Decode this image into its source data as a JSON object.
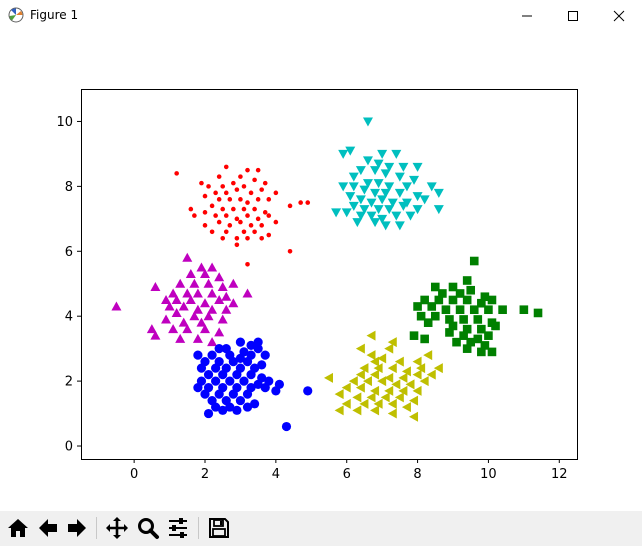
{
  "window": {
    "title": "Figure 1",
    "icon": "matplotlib-icon",
    "controls": [
      "minimize-icon",
      "maximize-icon",
      "close-icon"
    ]
  },
  "toolbar": {
    "buttons": [
      "home-icon",
      "back-icon",
      "forward-icon",
      "pan-icon",
      "zoom-icon",
      "configure-subplots-icon",
      "save-icon"
    ]
  },
  "chart_data": {
    "type": "scatter",
    "title": "",
    "xlabel": "",
    "ylabel": "",
    "xlim": [
      -1.5,
      12.5
    ],
    "ylim": [
      -0.4,
      11.0
    ],
    "xticks": [
      "0",
      "2",
      "4",
      "6",
      "8",
      "10",
      "12"
    ],
    "yticks": [
      "0",
      "2",
      "4",
      "6",
      "8",
      "10"
    ],
    "grid": false,
    "legend": "none",
    "series": [
      {
        "color": "#ff0000",
        "marker": "point",
        "points": [
          [
            1.2,
            8.4
          ],
          [
            2.6,
            8.6
          ],
          [
            3.2,
            8.5
          ],
          [
            3.5,
            8.5
          ],
          [
            2.4,
            8.3
          ],
          [
            3.0,
            8.3
          ],
          [
            1.9,
            8.1
          ],
          [
            2.1,
            8.0
          ],
          [
            2.5,
            8.0
          ],
          [
            2.8,
            8.1
          ],
          [
            3.1,
            8.0
          ],
          [
            3.4,
            8.2
          ],
          [
            3.7,
            8.1
          ],
          [
            2.3,
            7.8
          ],
          [
            2.6,
            7.8
          ],
          [
            2.9,
            7.9
          ],
          [
            3.3,
            7.8
          ],
          [
            3.6,
            7.9
          ],
          [
            4.0,
            7.8
          ],
          [
            2.0,
            7.7
          ],
          [
            2.4,
            7.6
          ],
          [
            2.7,
            7.6
          ],
          [
            3.0,
            7.6
          ],
          [
            3.2,
            7.5
          ],
          [
            3.5,
            7.6
          ],
          [
            3.8,
            7.6
          ],
          [
            4.7,
            7.5
          ],
          [
            4.9,
            7.5
          ],
          [
            1.6,
            7.3
          ],
          [
            2.2,
            7.4
          ],
          [
            2.5,
            7.3
          ],
          [
            2.8,
            7.3
          ],
          [
            3.1,
            7.3
          ],
          [
            3.4,
            7.3
          ],
          [
            3.7,
            7.2
          ],
          [
            4.4,
            7.4
          ],
          [
            1.7,
            7.1
          ],
          [
            2.0,
            7.2
          ],
          [
            2.3,
            7.1
          ],
          [
            2.6,
            7.1
          ],
          [
            2.9,
            7.0
          ],
          [
            3.2,
            7.1
          ],
          [
            3.5,
            7.0
          ],
          [
            3.8,
            7.1
          ],
          [
            2.0,
            6.8
          ],
          [
            2.4,
            6.9
          ],
          [
            2.7,
            6.8
          ],
          [
            3.0,
            6.9
          ],
          [
            3.3,
            6.8
          ],
          [
            3.6,
            6.8
          ],
          [
            4.0,
            6.9
          ],
          [
            2.2,
            6.6
          ],
          [
            2.6,
            6.6
          ],
          [
            3.1,
            6.6
          ],
          [
            3.4,
            6.6
          ],
          [
            3.8,
            6.5
          ],
          [
            2.5,
            6.4
          ],
          [
            2.9,
            6.4
          ],
          [
            3.2,
            6.4
          ],
          [
            3.6,
            6.4
          ],
          [
            2.9,
            6.2
          ],
          [
            4.4,
            6.0
          ],
          [
            3.2,
            5.6
          ]
        ]
      },
      {
        "color": "#00bfbf",
        "marker": "triangle_down",
        "points": [
          [
            6.6,
            10.0
          ],
          [
            5.9,
            9.0
          ],
          [
            6.1,
            9.1
          ],
          [
            7.0,
            9.0
          ],
          [
            7.4,
            9.0
          ],
          [
            6.6,
            8.8
          ],
          [
            6.9,
            8.7
          ],
          [
            7.2,
            8.6
          ],
          [
            6.4,
            8.5
          ],
          [
            7.6,
            8.6
          ],
          [
            8.0,
            8.6
          ],
          [
            6.8,
            8.5
          ],
          [
            7.1,
            8.4
          ],
          [
            6.2,
            8.3
          ],
          [
            7.5,
            8.3
          ],
          [
            7.9,
            8.2
          ],
          [
            6.6,
            8.1
          ],
          [
            6.9,
            8.1
          ],
          [
            7.2,
            8.0
          ],
          [
            5.9,
            8.0
          ],
          [
            6.2,
            8.0
          ],
          [
            7.7,
            8.0
          ],
          [
            8.4,
            8.0
          ],
          [
            6.5,
            7.9
          ],
          [
            6.8,
            7.8
          ],
          [
            7.1,
            7.8
          ],
          [
            7.5,
            7.8
          ],
          [
            8.0,
            7.7
          ],
          [
            8.6,
            7.8
          ],
          [
            6.1,
            7.7
          ],
          [
            6.4,
            7.6
          ],
          [
            6.7,
            7.5
          ],
          [
            7.0,
            7.6
          ],
          [
            7.3,
            7.5
          ],
          [
            7.7,
            7.5
          ],
          [
            8.2,
            7.6
          ],
          [
            6.2,
            7.4
          ],
          [
            6.5,
            7.3
          ],
          [
            6.9,
            7.3
          ],
          [
            7.2,
            7.3
          ],
          [
            7.6,
            7.4
          ],
          [
            8.0,
            7.3
          ],
          [
            8.6,
            7.3
          ],
          [
            5.7,
            7.2
          ],
          [
            6.0,
            7.2
          ],
          [
            6.4,
            7.1
          ],
          [
            6.7,
            7.1
          ],
          [
            7.0,
            7.0
          ],
          [
            7.4,
            7.1
          ],
          [
            7.8,
            7.1
          ],
          [
            6.3,
            6.9
          ],
          [
            6.8,
            6.9
          ],
          [
            7.5,
            6.8
          ],
          [
            7.1,
            6.8
          ]
        ]
      },
      {
        "color": "#bf00bf",
        "marker": "triangle_up",
        "points": [
          [
            1.5,
            5.8
          ],
          [
            1.9,
            5.5
          ],
          [
            2.2,
            5.5
          ],
          [
            1.6,
            5.3
          ],
          [
            2.0,
            5.3
          ],
          [
            2.4,
            5.2
          ],
          [
            0.6,
            4.9
          ],
          [
            1.3,
            5.0
          ],
          [
            1.7,
            5.0
          ],
          [
            2.1,
            5.0
          ],
          [
            2.5,
            4.9
          ],
          [
            2.8,
            5.0
          ],
          [
            1.1,
            4.7
          ],
          [
            1.5,
            4.7
          ],
          [
            1.8,
            4.7
          ],
          [
            2.2,
            4.7
          ],
          [
            2.6,
            4.6
          ],
          [
            3.2,
            4.7
          ],
          [
            0.9,
            4.5
          ],
          [
            1.2,
            4.5
          ],
          [
            1.6,
            4.5
          ],
          [
            2.0,
            4.4
          ],
          [
            2.4,
            4.5
          ],
          [
            2.8,
            4.4
          ],
          [
            -0.5,
            4.3
          ],
          [
            1.0,
            4.3
          ],
          [
            1.4,
            4.3
          ],
          [
            1.8,
            4.2
          ],
          [
            2.2,
            4.2
          ],
          [
            2.6,
            4.2
          ],
          [
            1.2,
            4.1
          ],
          [
            1.7,
            4.0
          ],
          [
            2.1,
            4.0
          ],
          [
            2.5,
            3.9
          ],
          [
            0.9,
            3.9
          ],
          [
            1.4,
            3.8
          ],
          [
            1.9,
            3.8
          ],
          [
            0.5,
            3.6
          ],
          [
            1.1,
            3.6
          ],
          [
            1.5,
            3.6
          ],
          [
            2.0,
            3.6
          ],
          [
            2.4,
            3.5
          ],
          [
            0.6,
            3.4
          ],
          [
            1.8,
            3.3
          ],
          [
            2.2,
            3.2
          ],
          [
            1.3,
            3.3
          ]
        ]
      },
      {
        "color": "#0000ff",
        "marker": "circle",
        "points": [
          [
            3.5,
            3.2
          ],
          [
            3.0,
            3.2
          ],
          [
            3.3,
            3.1
          ],
          [
            2.6,
            3.0
          ],
          [
            2.4,
            3.0
          ],
          [
            3.5,
            3.0
          ],
          [
            3.1,
            2.9
          ],
          [
            1.8,
            2.8
          ],
          [
            2.2,
            2.8
          ],
          [
            2.7,
            2.8
          ],
          [
            3.0,
            2.7
          ],
          [
            3.3,
            2.8
          ],
          [
            3.7,
            2.8
          ],
          [
            2.0,
            2.6
          ],
          [
            2.4,
            2.6
          ],
          [
            2.8,
            2.6
          ],
          [
            3.2,
            2.6
          ],
          [
            3.6,
            2.5
          ],
          [
            1.9,
            2.4
          ],
          [
            2.3,
            2.4
          ],
          [
            2.6,
            2.4
          ],
          [
            3.0,
            2.4
          ],
          [
            3.4,
            2.4
          ],
          [
            2.1,
            2.2
          ],
          [
            2.5,
            2.2
          ],
          [
            2.9,
            2.2
          ],
          [
            3.3,
            2.2
          ],
          [
            3.6,
            2.1
          ],
          [
            1.9,
            2.0
          ],
          [
            2.3,
            2.0
          ],
          [
            2.7,
            2.0
          ],
          [
            3.1,
            2.0
          ],
          [
            3.5,
            1.9
          ],
          [
            3.8,
            2.0
          ],
          [
            4.1,
            1.9
          ],
          [
            1.8,
            1.8
          ],
          [
            2.1,
            1.8
          ],
          [
            2.5,
            1.8
          ],
          [
            2.9,
            1.8
          ],
          [
            3.3,
            1.8
          ],
          [
            3.7,
            1.8
          ],
          [
            4.0,
            1.7
          ],
          [
            4.9,
            1.7
          ],
          [
            2.0,
            1.6
          ],
          [
            2.4,
            1.6
          ],
          [
            2.8,
            1.6
          ],
          [
            3.2,
            1.6
          ],
          [
            2.2,
            1.4
          ],
          [
            2.6,
            1.4
          ],
          [
            3.0,
            1.4
          ],
          [
            3.4,
            1.3
          ],
          [
            2.3,
            1.2
          ],
          [
            2.7,
            1.2
          ],
          [
            3.2,
            1.2
          ],
          [
            2.9,
            1.1
          ],
          [
            2.1,
            1.0
          ],
          [
            2.5,
            1.1
          ],
          [
            4.3,
            0.6
          ]
        ]
      },
      {
        "color": "#bfbf00",
        "marker": "triangle_left",
        "points": [
          [
            6.7,
            3.4
          ],
          [
            7.3,
            3.2
          ],
          [
            7.2,
            3.0
          ],
          [
            6.4,
            3.0
          ],
          [
            6.7,
            2.8
          ],
          [
            7.0,
            2.7
          ],
          [
            8.3,
            2.8
          ],
          [
            6.8,
            2.6
          ],
          [
            7.5,
            2.6
          ],
          [
            8.0,
            2.6
          ],
          [
            6.5,
            2.4
          ],
          [
            6.9,
            2.4
          ],
          [
            7.3,
            2.4
          ],
          [
            7.7,
            2.3
          ],
          [
            8.1,
            2.4
          ],
          [
            8.6,
            2.4
          ],
          [
            6.4,
            2.2
          ],
          [
            6.8,
            2.2
          ],
          [
            7.2,
            2.1
          ],
          [
            7.6,
            2.1
          ],
          [
            8.0,
            2.2
          ],
          [
            8.4,
            2.2
          ],
          [
            5.5,
            2.1
          ],
          [
            6.2,
            2.0
          ],
          [
            6.6,
            2.0
          ],
          [
            7.0,
            2.0
          ],
          [
            7.4,
            1.9
          ],
          [
            7.8,
            1.9
          ],
          [
            8.2,
            2.0
          ],
          [
            6.0,
            1.8
          ],
          [
            6.4,
            1.8
          ],
          [
            6.8,
            1.7
          ],
          [
            7.2,
            1.7
          ],
          [
            7.6,
            1.7
          ],
          [
            8.0,
            1.7
          ],
          [
            5.8,
            1.6
          ],
          [
            6.3,
            1.5
          ],
          [
            6.7,
            1.5
          ],
          [
            7.1,
            1.5
          ],
          [
            7.5,
            1.5
          ],
          [
            7.9,
            1.4
          ],
          [
            6.0,
            1.3
          ],
          [
            6.5,
            1.3
          ],
          [
            6.9,
            1.3
          ],
          [
            7.3,
            1.3
          ],
          [
            7.7,
            1.2
          ],
          [
            5.8,
            1.1
          ],
          [
            6.3,
            1.1
          ],
          [
            6.8,
            1.1
          ],
          [
            7.3,
            1.0
          ],
          [
            7.9,
            0.9
          ]
        ]
      },
      {
        "color": "#008000",
        "marker": "square",
        "points": [
          [
            9.6,
            5.7
          ],
          [
            9.4,
            5.1
          ],
          [
            8.5,
            4.9
          ],
          [
            9.0,
            4.9
          ],
          [
            9.5,
            4.8
          ],
          [
            8.7,
            4.7
          ],
          [
            9.2,
            4.7
          ],
          [
            9.9,
            4.6
          ],
          [
            8.2,
            4.5
          ],
          [
            8.6,
            4.5
          ],
          [
            9.0,
            4.5
          ],
          [
            9.4,
            4.5
          ],
          [
            9.8,
            4.4
          ],
          [
            10.1,
            4.5
          ],
          [
            8.0,
            4.3
          ],
          [
            8.4,
            4.3
          ],
          [
            8.8,
            4.2
          ],
          [
            9.2,
            4.2
          ],
          [
            9.6,
            4.2
          ],
          [
            10.0,
            4.2
          ],
          [
            10.4,
            4.2
          ],
          [
            11.0,
            4.2
          ],
          [
            11.4,
            4.1
          ],
          [
            8.1,
            4.0
          ],
          [
            8.5,
            4.0
          ],
          [
            8.9,
            3.9
          ],
          [
            9.3,
            3.9
          ],
          [
            9.7,
            3.9
          ],
          [
            10.1,
            3.8
          ],
          [
            8.3,
            3.8
          ],
          [
            9.0,
            3.7
          ],
          [
            9.4,
            3.6
          ],
          [
            9.8,
            3.6
          ],
          [
            10.2,
            3.7
          ],
          [
            8.9,
            3.5
          ],
          [
            9.3,
            3.4
          ],
          [
            9.7,
            3.3
          ],
          [
            10.0,
            3.4
          ],
          [
            7.9,
            3.4
          ],
          [
            8.2,
            3.3
          ],
          [
            9.1,
            3.2
          ],
          [
            9.5,
            3.2
          ],
          [
            9.9,
            3.1
          ],
          [
            9.4,
            3.0
          ],
          [
            9.8,
            2.9
          ],
          [
            10.1,
            2.9
          ]
        ]
      }
    ]
  }
}
